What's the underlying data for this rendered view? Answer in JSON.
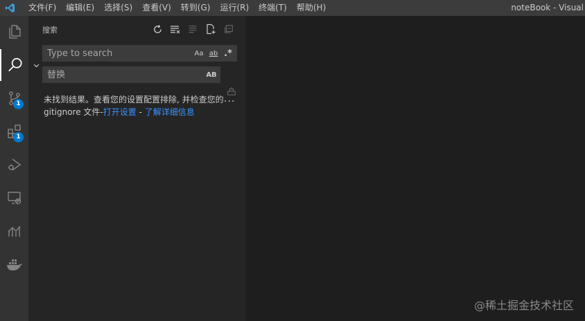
{
  "titlebar": {
    "menu": [
      {
        "label": "文件(F)"
      },
      {
        "label": "编辑(E)"
      },
      {
        "label": "选择(S)"
      },
      {
        "label": "查看(V)"
      },
      {
        "label": "转到(G)"
      },
      {
        "label": "运行(R)"
      },
      {
        "label": "终端(T)"
      },
      {
        "label": "帮助(H)"
      }
    ],
    "window_title": "noteBook - Visual"
  },
  "activitybar": {
    "items": [
      {
        "icon": "explorer-icon"
      },
      {
        "icon": "search-icon"
      },
      {
        "icon": "source-control-icon",
        "badge": "1"
      },
      {
        "icon": "extensions-icon",
        "badge": "1"
      },
      {
        "icon": "run-debug-icon"
      },
      {
        "icon": "remote-explorer-icon"
      },
      {
        "icon": "timeline-chart-icon"
      },
      {
        "icon": "docker-icon"
      }
    ]
  },
  "sidebar": {
    "title": "搜索",
    "search": {
      "value": "",
      "placeholder": "Type to search",
      "match_case": "Aa",
      "whole_word": "ab",
      "regex": ".*"
    },
    "replace": {
      "value": "",
      "placeholder": "替换",
      "preserve_case": "AB"
    },
    "message": {
      "text1": "未找到结果。查看您的设置配置排除, 并检查您的 gitignore 文件-",
      "link1": "打开设置",
      "sep": " - ",
      "link2": "了解详细信息"
    },
    "more": "···"
  },
  "watermark": "@稀土掘金技术社区",
  "colors": {
    "accent": "#007acc",
    "link": "#3794ff",
    "titlebar": "#3c3c3c",
    "activitybar": "#333333",
    "sidebar": "#252526",
    "editor": "#1e1e1e"
  }
}
